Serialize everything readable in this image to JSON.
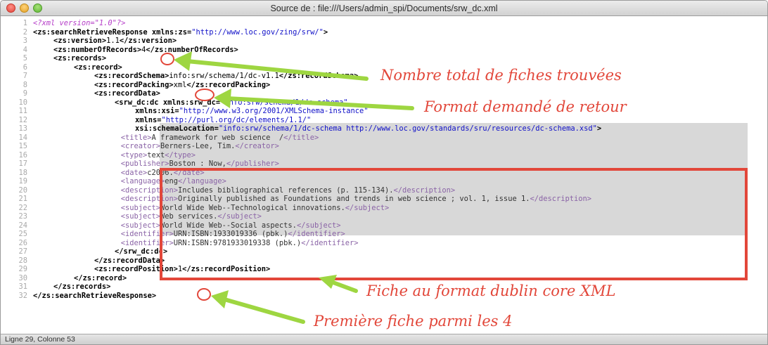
{
  "window": {
    "title": "Source de : file:///Users/admin_spi/Documents/srw_dc.xml"
  },
  "code_lines": [
    {
      "n": "1",
      "ind": 0,
      "segs": [
        [
          "pi",
          "<?xml version=\"1.0\"?>"
        ]
      ]
    },
    {
      "n": "2",
      "ind": 0,
      "segs": [
        [
          "tag",
          "<zs:searchRetrieveResponse "
        ],
        [
          "attr",
          "xmlns:zs"
        ],
        [
          "tag",
          "="
        ],
        [
          "val",
          "\"http://www.loc.gov/zing/srw/\""
        ],
        [
          "tag",
          ">"
        ]
      ]
    },
    {
      "n": "3",
      "ind": 1,
      "segs": [
        [
          "tag",
          "<zs:version>"
        ],
        [
          "text",
          "1.1"
        ],
        [
          "tag",
          "</zs:version>"
        ]
      ]
    },
    {
      "n": "4",
      "ind": 1,
      "segs": [
        [
          "tag",
          "<zs:numberOfRecords>"
        ],
        [
          "text",
          "4"
        ],
        [
          "tag",
          "</zs:numberOfRecords>"
        ]
      ]
    },
    {
      "n": "5",
      "ind": 1,
      "segs": [
        [
          "tag",
          "<zs:records>"
        ]
      ]
    },
    {
      "n": "6",
      "ind": 2,
      "segs": [
        [
          "tag",
          "<zs:record>"
        ]
      ]
    },
    {
      "n": "7",
      "ind": 3,
      "segs": [
        [
          "tag",
          "<zs:recordSchema>"
        ],
        [
          "text",
          "info:srw/schema/1/dc-v1.1"
        ],
        [
          "tag",
          "</zs:recordSchema>"
        ]
      ]
    },
    {
      "n": "8",
      "ind": 3,
      "segs": [
        [
          "tag",
          "<zs:recordPacking>"
        ],
        [
          "text",
          "xml"
        ],
        [
          "tag",
          "</zs:recordPacking>"
        ]
      ]
    },
    {
      "n": "9",
      "ind": 3,
      "segs": [
        [
          "tag",
          "<zs:recordData>"
        ]
      ]
    },
    {
      "n": "10",
      "ind": 4,
      "segs": [
        [
          "tag",
          "<srw_dc:dc "
        ],
        [
          "attr",
          "xmlns:srw_dc"
        ],
        [
          "tag",
          "="
        ],
        [
          "val",
          "\"info:srw/schema/1/dc-schema\""
        ]
      ]
    },
    {
      "n": "11",
      "ind": 5,
      "segs": [
        [
          "attr",
          "xmlns:xsi"
        ],
        [
          "tag",
          "="
        ],
        [
          "val",
          "\"http://www.w3.org/2001/XMLSchema-instance\""
        ]
      ]
    },
    {
      "n": "12",
      "ind": 5,
      "segs": [
        [
          "attr",
          "xmlns"
        ],
        [
          "tag",
          "="
        ],
        [
          "val",
          "\"http://purl.org/dc/elements/1.1/\""
        ]
      ]
    },
    {
      "n": "13",
      "ind": 5,
      "segs": [
        [
          "attr",
          "xsi:schemaLocation"
        ],
        [
          "tag",
          "="
        ],
        [
          "val",
          "\"info:srw/schema/1/dc-schema http://www.loc.gov/standards/sru/resources/dc-schema.xsd\""
        ],
        [
          "tag",
          ">"
        ]
      ]
    },
    {
      "n": "14",
      "ind": 4.3,
      "segs": [
        [
          "gtag",
          "<title>"
        ],
        [
          "gtext",
          "A framework for web science  /"
        ],
        [
          "gtag",
          "</title>"
        ]
      ]
    },
    {
      "n": "15",
      "ind": 4.3,
      "segs": [
        [
          "gtag",
          "<creator>"
        ],
        [
          "gtext",
          "Berners-Lee, Tim."
        ],
        [
          "gtag",
          "</creator>"
        ]
      ]
    },
    {
      "n": "16",
      "ind": 4.3,
      "segs": [
        [
          "gtag",
          "<type>"
        ],
        [
          "gtext",
          "text"
        ],
        [
          "gtag",
          "</type>"
        ]
      ]
    },
    {
      "n": "17",
      "ind": 4.3,
      "segs": [
        [
          "gtag",
          "<publisher>"
        ],
        [
          "gtext",
          "Boston : Now,"
        ],
        [
          "gtag",
          "</publisher>"
        ]
      ]
    },
    {
      "n": "18",
      "ind": 4.3,
      "segs": [
        [
          "gtag",
          "<date>"
        ],
        [
          "gtext",
          "c2006."
        ],
        [
          "gtag",
          "</date>"
        ]
      ]
    },
    {
      "n": "19",
      "ind": 4.3,
      "segs": [
        [
          "gtag",
          "<language>"
        ],
        [
          "gtext",
          "eng"
        ],
        [
          "gtag",
          "</language>"
        ]
      ]
    },
    {
      "n": "20",
      "ind": 4.3,
      "segs": [
        [
          "gtag",
          "<description>"
        ],
        [
          "gtext",
          "Includes bibliographical references (p. 115-134)."
        ],
        [
          "gtag",
          "</description>"
        ]
      ]
    },
    {
      "n": "21",
      "ind": 4.3,
      "segs": [
        [
          "gtag",
          "<description>"
        ],
        [
          "gtext",
          "Originally published as Foundations and trends in web science ; vol. 1, issue 1."
        ],
        [
          "gtag",
          "</description>"
        ]
      ]
    },
    {
      "n": "22",
      "ind": 4.3,
      "segs": [
        [
          "gtag",
          "<subject>"
        ],
        [
          "gtext",
          "World Wide Web--Technological innovations."
        ],
        [
          "gtag",
          "</subject>"
        ]
      ]
    },
    {
      "n": "23",
      "ind": 4.3,
      "segs": [
        [
          "gtag",
          "<subject>"
        ],
        [
          "gtext",
          "Web services."
        ],
        [
          "gtag",
          "</subject>"
        ]
      ]
    },
    {
      "n": "24",
      "ind": 4.3,
      "segs": [
        [
          "gtag",
          "<subject>"
        ],
        [
          "gtext",
          "World Wide Web--Social aspects."
        ],
        [
          "gtag",
          "</subject>"
        ]
      ]
    },
    {
      "n": "25",
      "ind": 4.3,
      "segs": [
        [
          "gtag",
          "<identifier>"
        ],
        [
          "gtext",
          "URN:ISBN:1933019336 (pbk.)"
        ],
        [
          "gtag",
          "</identifier>"
        ]
      ]
    },
    {
      "n": "26",
      "ind": 4.3,
      "segs": [
        [
          "gtag",
          "<identifier>"
        ],
        [
          "gtext",
          "URN:ISBN:9781933019338 (pbk.)"
        ],
        [
          "gtag",
          "</identifier>"
        ]
      ]
    },
    {
      "n": "27",
      "ind": 4,
      "segs": [
        [
          "tag",
          "</srw_dc:dc>"
        ]
      ]
    },
    {
      "n": "28",
      "ind": 3,
      "segs": [
        [
          "tag",
          "</zs:recordData>"
        ]
      ]
    },
    {
      "n": "29",
      "ind": 3,
      "segs": [
        [
          "tag",
          "<zs:recordPosition>"
        ],
        [
          "text",
          "1"
        ],
        [
          "tag",
          "</zs:recordPosition>"
        ]
      ]
    },
    {
      "n": "30",
      "ind": 2,
      "segs": [
        [
          "tag",
          "</zs:record>"
        ]
      ]
    },
    {
      "n": "31",
      "ind": 1,
      "segs": [
        [
          "tag",
          "</zs:records>"
        ]
      ]
    },
    {
      "n": "32",
      "ind": 0,
      "segs": [
        [
          "tag",
          "</zs:searchRetrieveResponse>"
        ]
      ]
    }
  ],
  "annotations": {
    "total_records": "Nombre total de fiches trouvées",
    "format": "Format demandé de retour",
    "dublin_core": "Fiche au format dublin core XML",
    "first_record": "Première fiche parmi les 4"
  },
  "colors": {
    "annotation": "#e2473a",
    "arrow": "#9ed641"
  },
  "status": {
    "position": "Ligne 29, Colonne 53"
  }
}
